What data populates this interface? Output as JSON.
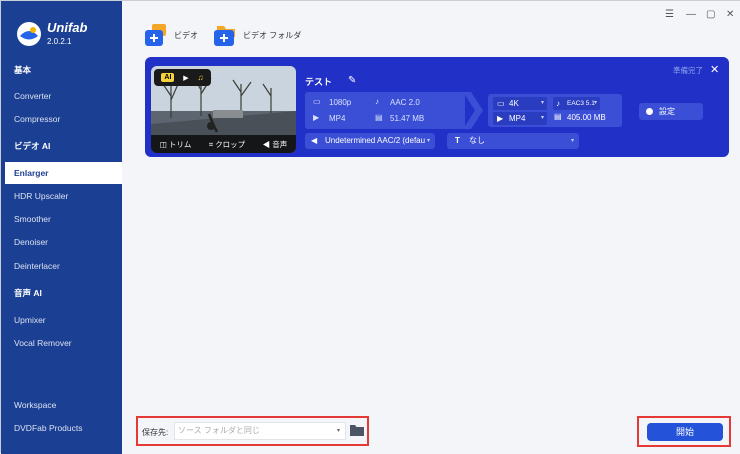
{
  "app": {
    "brand": "Unifab",
    "version": "2.0.2.1"
  },
  "sidebar": {
    "items": [
      {
        "label": "基本",
        "section": true
      },
      {
        "label": "Converter"
      },
      {
        "label": "Compressor"
      },
      {
        "label": "ビデオ AI",
        "section": true
      },
      {
        "label": "Enlarger",
        "active": true
      },
      {
        "label": "HDR Upscaler"
      },
      {
        "label": "Smoother"
      },
      {
        "label": "Denoiser"
      },
      {
        "label": "Deinterlacer"
      },
      {
        "label": "音声 AI",
        "section": true
      },
      {
        "label": "Upmixer"
      },
      {
        "label": "Vocal Remover"
      },
      {
        "label": "Workspace"
      },
      {
        "label": "DVDFab Products"
      }
    ]
  },
  "toolbar": {
    "add_video_label": "ビデオ",
    "add_folder_label": "ビデオ フォルダ"
  },
  "task": {
    "title": "テスト",
    "status": "準備完了",
    "thumb_tools": {
      "trim": "トリム",
      "crop": "クロップ",
      "audio": "音声"
    },
    "ai_badge": "AI",
    "source": {
      "resolution": "1080p",
      "audio_codec": "AAC 2.0",
      "container": "MP4",
      "size": "51.47 MB"
    },
    "output": {
      "resolution": "4K",
      "audio_codec": "EAC3 5.1",
      "container": "MP4",
      "size": "405.00 MB"
    },
    "settings_label": "設定",
    "audio_track": "Undetermined AAC/2 (defau",
    "subtitle": "なし"
  },
  "footer": {
    "save_label": "保存先:",
    "save_placeholder": "ソース フォルダと同じ",
    "start_label": "開始"
  },
  "colors": {
    "sidebar": "#1b3f92",
    "card": "#2130c7",
    "accent": "#2452d8",
    "highlight": "#e53935"
  }
}
